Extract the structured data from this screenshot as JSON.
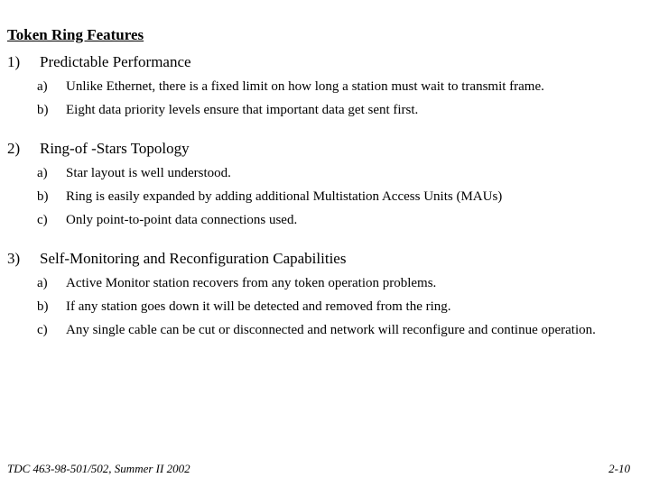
{
  "slide": {
    "title": "Token Ring Features",
    "groups": [
      {
        "marker": "1)",
        "heading": "Predictable Performance",
        "items": [
          {
            "marker": "a)",
            "text": "Unlike Ethernet, there is a fixed limit on how long a station must wait to transmit frame."
          },
          {
            "marker": "b)",
            "text": "Eight data priority levels ensure that important data get sent first."
          }
        ]
      },
      {
        "marker": "2)",
        "heading": "Ring-of -Stars Topology",
        "items": [
          {
            "marker": "a)",
            "text": "Star layout is well understood."
          },
          {
            "marker": "b)",
            "text": "Ring is easily expanded by adding additional Multistation Access Units (MAUs)"
          },
          {
            "marker": "c)",
            "text": "Only point-to-point data connections used."
          }
        ]
      },
      {
        "marker": "3)",
        "heading": "Self-Monitoring and Reconfiguration Capabilities",
        "items": [
          {
            "marker": "a)",
            "text": "Active Monitor station recovers from any token operation problems."
          },
          {
            "marker": "b)",
            "text": "If any station goes down it will be detected and removed from the ring."
          },
          {
            "marker": "c)",
            "text": "Any single cable can be cut or disconnected and network will reconfigure and continue operation."
          }
        ]
      }
    ],
    "footer": {
      "course": "TDC 463-98-501/502, Summer II 2002",
      "page_number": "2-10"
    },
    "colors": {
      "text": "#000000",
      "background": "#ffffff"
    }
  }
}
